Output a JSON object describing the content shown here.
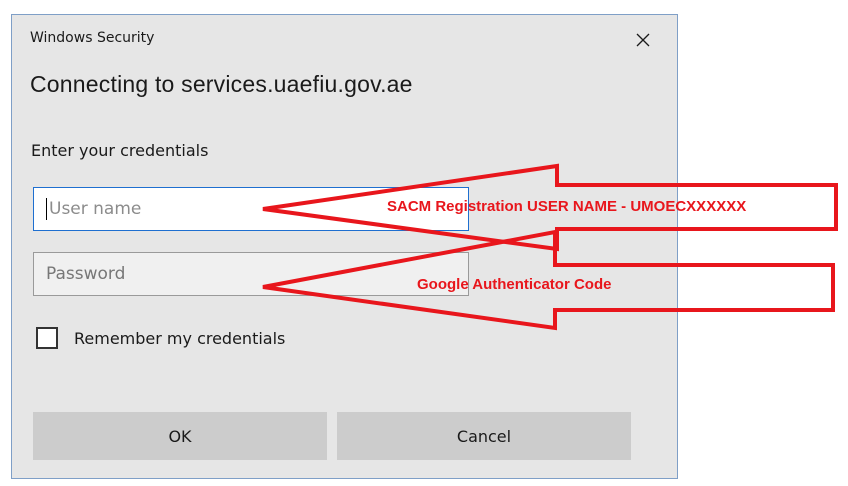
{
  "dialog": {
    "title": "Windows Security",
    "heading": "Connecting to services.uaefiu.gov.ae",
    "subheading": "Enter your credentials",
    "username": {
      "value": "",
      "placeholder": "User name"
    },
    "password": {
      "value": "",
      "placeholder": "Password"
    },
    "remember_label": "Remember my credentials",
    "remember_checked": false,
    "ok_label": "OK",
    "cancel_label": "Cancel"
  },
  "annotations": {
    "username_note": "SACM Registration USER NAME - UMOECXXXXXX",
    "password_note": "Google Authenticator Code",
    "color": "#e8161c"
  },
  "icons": {
    "close": "close-icon"
  }
}
